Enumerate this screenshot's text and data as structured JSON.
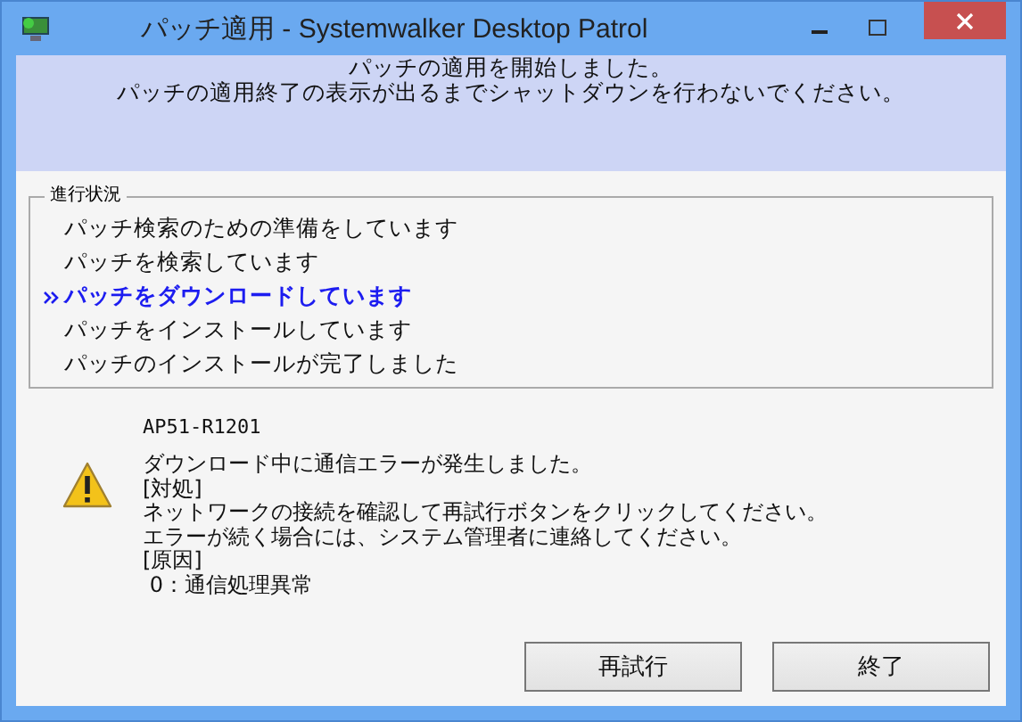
{
  "window": {
    "title": "パッチ適用 - Systemwalker Desktop Patrol"
  },
  "header": {
    "lines": [
      "パッチの適用を開始しました。",
      "パッチの適用終了の表示が出るまでシャットダウンを行わないでください。"
    ]
  },
  "progress": {
    "title": "進行状況",
    "steps": [
      {
        "label": "パッチ検索のための準備をしています",
        "current": false
      },
      {
        "label": "パッチを検索しています",
        "current": false
      },
      {
        "label": "パッチをダウンロードしています",
        "current": true
      },
      {
        "label": "パッチをインストールしています",
        "current": false
      },
      {
        "label": "パッチのインストールが完了しました",
        "current": false
      }
    ]
  },
  "message": {
    "code": "AP51-R1201",
    "lines": [
      "ダウンロード中に通信エラーが発生しました。",
      "[対処]",
      "ネットワークの接続を確認して再試行ボタンをクリックしてください。",
      "エラーが続く場合には、システム管理者に連絡してください。",
      "[原因]",
      " 0：通信処理異常"
    ]
  },
  "buttons": [
    "再試行",
    "終了"
  ]
}
